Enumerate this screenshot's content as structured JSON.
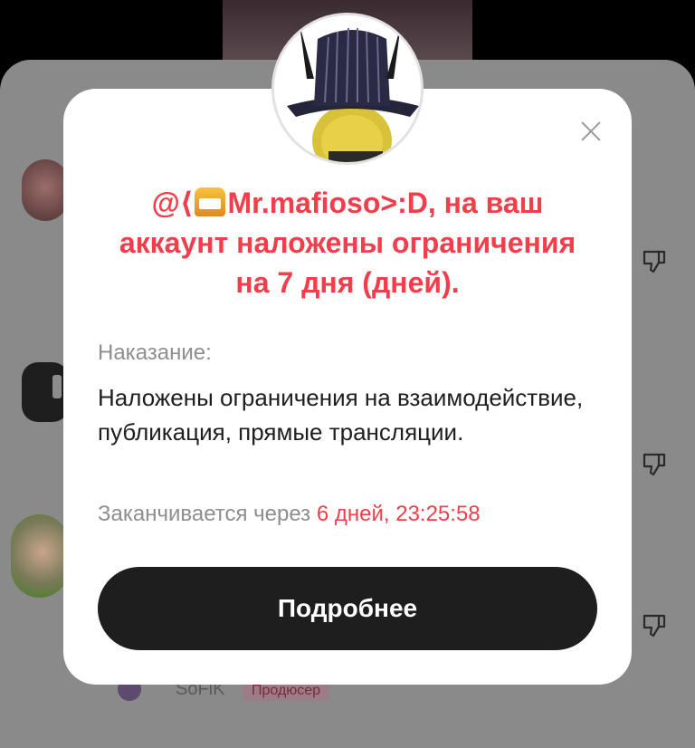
{
  "modal": {
    "title_prefix": "@⟨",
    "title_rest": "Mr.mafioso>:D, на ваш аккаунт наложены ограничения на 7 дня (дней).",
    "punishment_label": "Наказание:",
    "punishment_text": "Наложены ограничения на взаимодействие, публикация, прямые трансляции.",
    "expires_prefix": "Заканчивается через",
    "expires_days": "6 дней,",
    "expires_time": "23:25:58",
    "details_button": "Подробнее"
  },
  "background": {
    "visible_username": "SoFiK",
    "visible_badge": "Продюсер"
  },
  "colors": {
    "accent_red": "#f23d4a",
    "button_dark": "#1e1e1e",
    "overlay_gray": "#8a8a8a"
  },
  "icons": [
    "close-icon",
    "dislike-icon",
    "slot-machine-emoji"
  ]
}
